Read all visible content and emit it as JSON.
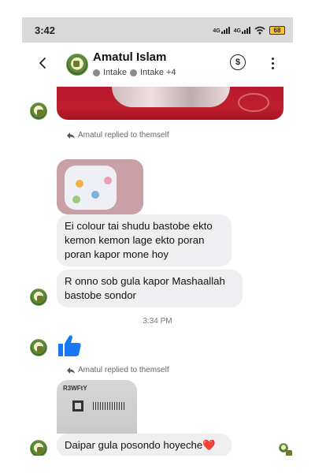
{
  "status_bar": {
    "time": "3:42",
    "network1": "4G",
    "network2": "4G",
    "battery": "68"
  },
  "header": {
    "name": "Amatul Islam",
    "tag1": "Intake",
    "tag2": "Intake +4"
  },
  "messages": {
    "reply1_label": "Amatul replied to themself",
    "bubble1": "Ei colour tai shudu bastobe ekto kemon kemon lage ekto poran poran kapor mone hoy",
    "bubble2": "R onno sob gula kapor Mashaallah bastobe sondor",
    "timestamp": "3:34 PM",
    "reply2_label": "Amatul replied to themself",
    "box_label": "R3WFtY",
    "bubble3": "Daipar gula posondo hoyeche❤️"
  },
  "colors": {
    "bubble": "#efeff1",
    "like": "#1877f2",
    "status_bg": "#d9d9d9"
  },
  "icons": [
    "back-arrow-icon",
    "dollar-icon",
    "more-icon",
    "reply-icon",
    "thumbs-up-icon",
    "avatar"
  ]
}
